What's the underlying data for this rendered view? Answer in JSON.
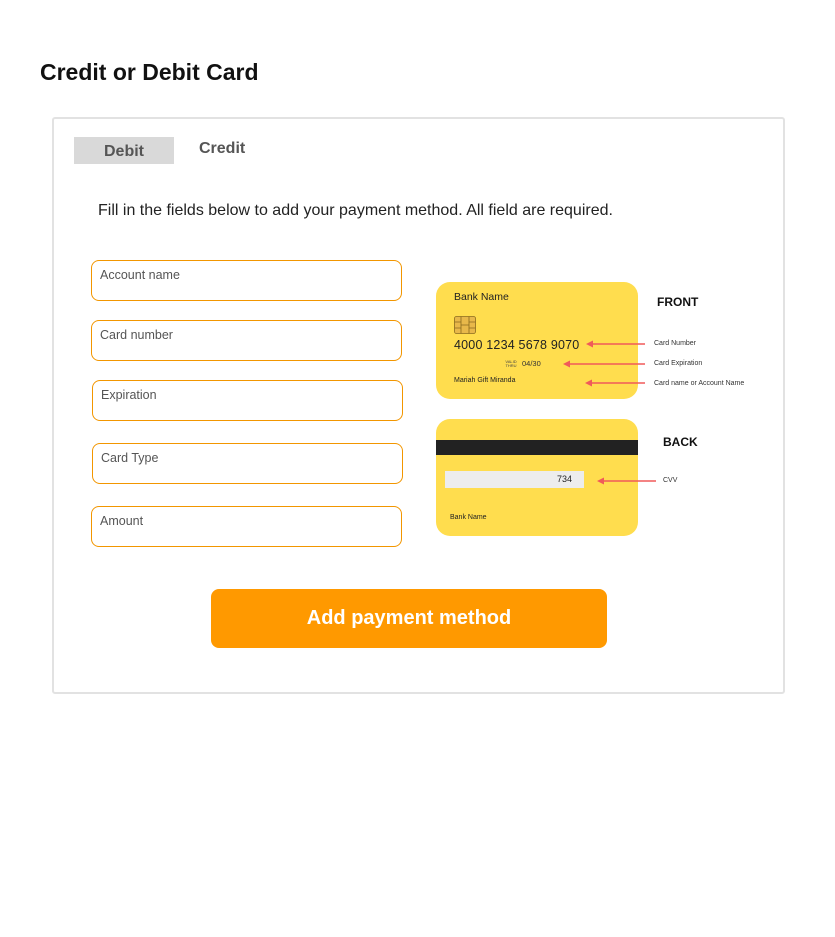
{
  "page": {
    "title": "Credit or Debit Card"
  },
  "tabs": [
    {
      "label": "Debit",
      "active": true
    },
    {
      "label": "Credit",
      "active": false
    }
  ],
  "instructions": "Fill in the fields below to add your payment method. All field are required.",
  "fields": [
    {
      "label": "Account name",
      "value": ""
    },
    {
      "label": "Card number",
      "value": ""
    },
    {
      "label": "Expiration",
      "value": ""
    },
    {
      "label": "Card Type",
      "value": ""
    },
    {
      "label": "Amount",
      "value": ""
    }
  ],
  "card_front": {
    "heading": "FRONT",
    "bank_name": "Bank Name",
    "number": "4000 1234 5678 9070",
    "valid_thru": "VALID THRU",
    "expiry": "04/30",
    "holder": "Mariah Gift Miranda",
    "annotations": {
      "number": "Card Number",
      "expiration": "Card Expiration",
      "name": "Card name or Account Name"
    }
  },
  "card_back": {
    "heading": "BACK",
    "cvv": "734",
    "bank_name": "Bank Name",
    "annotations": {
      "cvv": "CVV"
    }
  },
  "submit_label": "Add payment method",
  "colors": {
    "accent": "#ff9900",
    "field_border": "#f29600",
    "card": "#ffdd4e",
    "arrow": "#f05a5a",
    "active_tab": "#d9d9d9"
  }
}
